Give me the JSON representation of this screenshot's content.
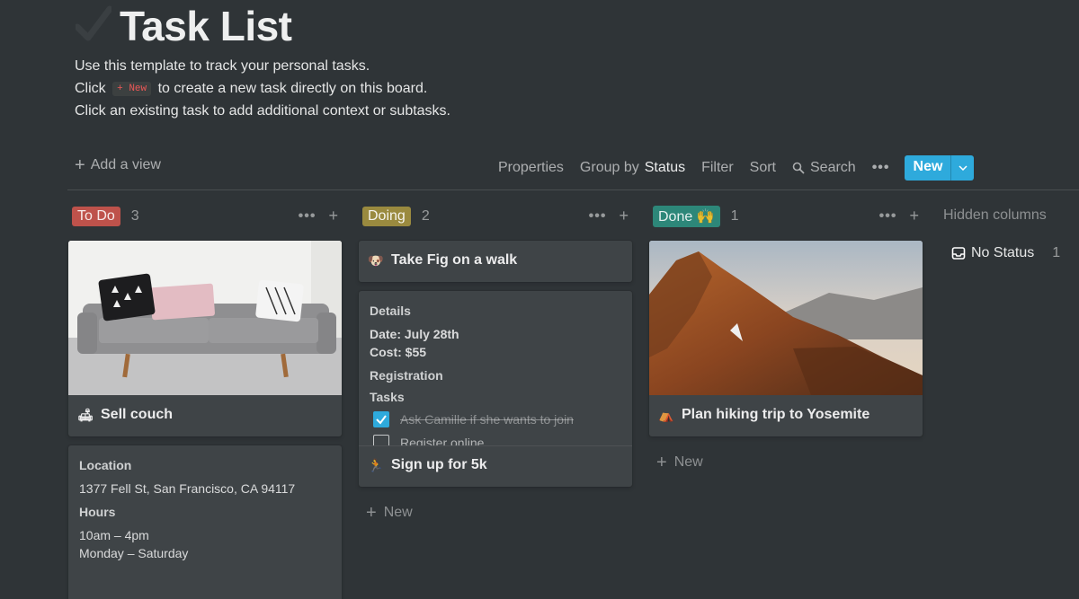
{
  "page": {
    "title": "Task List",
    "desc_line1": "Use this template to track your personal tasks.",
    "desc_line2_pre": "Click",
    "desc_line2_code": "+ New",
    "desc_line2_post": "to create a new task directly on this board.",
    "desc_line3": "Click an existing task to add additional context or subtasks."
  },
  "toolbar": {
    "add_view": "Add a view",
    "properties": "Properties",
    "group_by": "Group by",
    "group_by_value": "Status",
    "filter": "Filter",
    "sort": "Sort",
    "search": "Search",
    "more": "•••",
    "new": "New"
  },
  "columns": [
    {
      "label": "To Do",
      "count": "3"
    },
    {
      "label": "Doing",
      "count": "2"
    },
    {
      "label": "Done 🙌",
      "count": "1"
    }
  ],
  "hidden": {
    "label": "Hidden columns",
    "no_status": "No Status",
    "no_status_count": "1"
  },
  "cards": {
    "sell_couch": {
      "title": "Sell couch"
    },
    "couch_details": {
      "location_label": "Location",
      "location": "1377 Fell St, San Francisco, CA 94117",
      "hours_label": "Hours",
      "hours1": "10am – 4pm",
      "hours2": "Monday – Saturday"
    },
    "fig_walk": {
      "title": "Take Fig on a walk"
    },
    "signup": {
      "details_label": "Details",
      "date": "Date: July 28th",
      "cost": "Cost: $55",
      "registration": "Registration",
      "tasks": "Tasks",
      "task1": "Ask Camille if she wants to join",
      "task2": "Register online",
      "title": "Sign up for 5k"
    },
    "hiking": {
      "title": "Plan hiking trip to Yosemite"
    }
  },
  "add_new": "New",
  "colors": {
    "accent": "#2eaadc",
    "todo": "#be524b",
    "doing": "#9a8a3f",
    "done": "#2d8779",
    "bg": "#2f3437",
    "card": "#3f4447"
  }
}
